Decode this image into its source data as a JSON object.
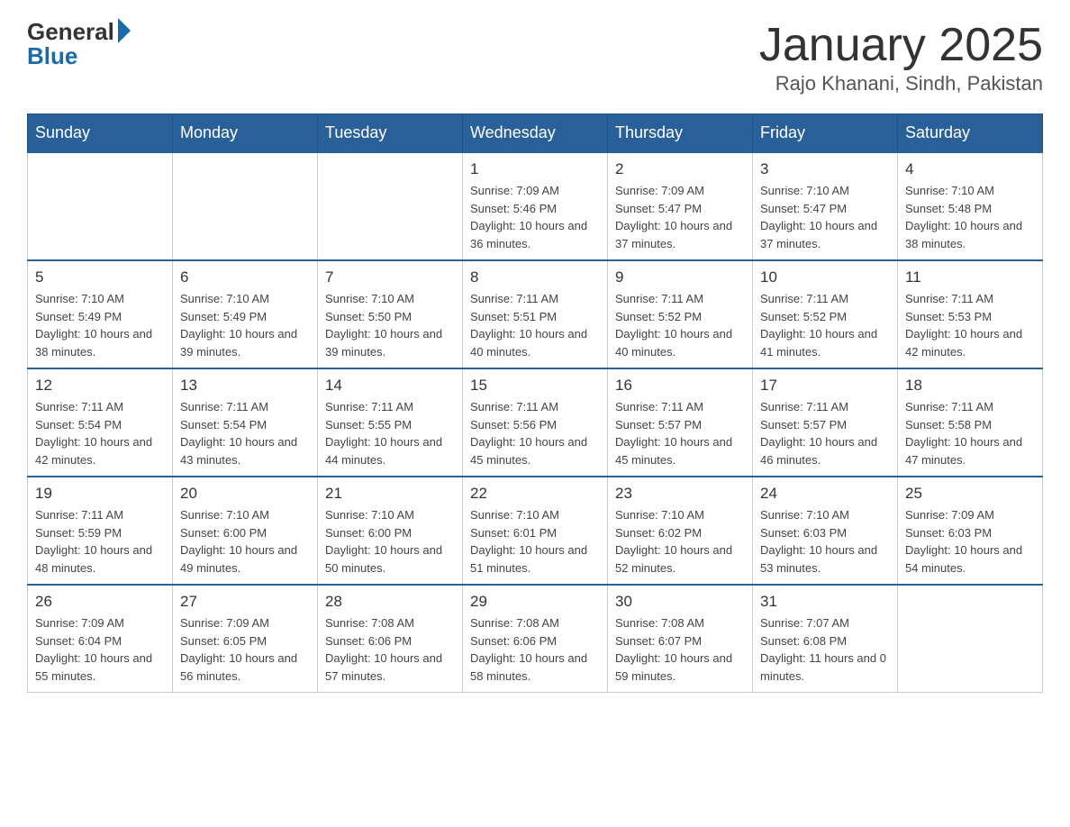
{
  "header": {
    "logo_general": "General",
    "logo_blue": "Blue",
    "month_title": "January 2025",
    "location": "Rajo Khanani, Sindh, Pakistan"
  },
  "weekdays": [
    "Sunday",
    "Monday",
    "Tuesday",
    "Wednesday",
    "Thursday",
    "Friday",
    "Saturday"
  ],
  "weeks": [
    [
      {
        "day": "",
        "info": ""
      },
      {
        "day": "",
        "info": ""
      },
      {
        "day": "",
        "info": ""
      },
      {
        "day": "1",
        "info": "Sunrise: 7:09 AM\nSunset: 5:46 PM\nDaylight: 10 hours and 36 minutes."
      },
      {
        "day": "2",
        "info": "Sunrise: 7:09 AM\nSunset: 5:47 PM\nDaylight: 10 hours and 37 minutes."
      },
      {
        "day": "3",
        "info": "Sunrise: 7:10 AM\nSunset: 5:47 PM\nDaylight: 10 hours and 37 minutes."
      },
      {
        "day": "4",
        "info": "Sunrise: 7:10 AM\nSunset: 5:48 PM\nDaylight: 10 hours and 38 minutes."
      }
    ],
    [
      {
        "day": "5",
        "info": "Sunrise: 7:10 AM\nSunset: 5:49 PM\nDaylight: 10 hours and 38 minutes."
      },
      {
        "day": "6",
        "info": "Sunrise: 7:10 AM\nSunset: 5:49 PM\nDaylight: 10 hours and 39 minutes."
      },
      {
        "day": "7",
        "info": "Sunrise: 7:10 AM\nSunset: 5:50 PM\nDaylight: 10 hours and 39 minutes."
      },
      {
        "day": "8",
        "info": "Sunrise: 7:11 AM\nSunset: 5:51 PM\nDaylight: 10 hours and 40 minutes."
      },
      {
        "day": "9",
        "info": "Sunrise: 7:11 AM\nSunset: 5:52 PM\nDaylight: 10 hours and 40 minutes."
      },
      {
        "day": "10",
        "info": "Sunrise: 7:11 AM\nSunset: 5:52 PM\nDaylight: 10 hours and 41 minutes."
      },
      {
        "day": "11",
        "info": "Sunrise: 7:11 AM\nSunset: 5:53 PM\nDaylight: 10 hours and 42 minutes."
      }
    ],
    [
      {
        "day": "12",
        "info": "Sunrise: 7:11 AM\nSunset: 5:54 PM\nDaylight: 10 hours and 42 minutes."
      },
      {
        "day": "13",
        "info": "Sunrise: 7:11 AM\nSunset: 5:54 PM\nDaylight: 10 hours and 43 minutes."
      },
      {
        "day": "14",
        "info": "Sunrise: 7:11 AM\nSunset: 5:55 PM\nDaylight: 10 hours and 44 minutes."
      },
      {
        "day": "15",
        "info": "Sunrise: 7:11 AM\nSunset: 5:56 PM\nDaylight: 10 hours and 45 minutes."
      },
      {
        "day": "16",
        "info": "Sunrise: 7:11 AM\nSunset: 5:57 PM\nDaylight: 10 hours and 45 minutes."
      },
      {
        "day": "17",
        "info": "Sunrise: 7:11 AM\nSunset: 5:57 PM\nDaylight: 10 hours and 46 minutes."
      },
      {
        "day": "18",
        "info": "Sunrise: 7:11 AM\nSunset: 5:58 PM\nDaylight: 10 hours and 47 minutes."
      }
    ],
    [
      {
        "day": "19",
        "info": "Sunrise: 7:11 AM\nSunset: 5:59 PM\nDaylight: 10 hours and 48 minutes."
      },
      {
        "day": "20",
        "info": "Sunrise: 7:10 AM\nSunset: 6:00 PM\nDaylight: 10 hours and 49 minutes."
      },
      {
        "day": "21",
        "info": "Sunrise: 7:10 AM\nSunset: 6:00 PM\nDaylight: 10 hours and 50 minutes."
      },
      {
        "day": "22",
        "info": "Sunrise: 7:10 AM\nSunset: 6:01 PM\nDaylight: 10 hours and 51 minutes."
      },
      {
        "day": "23",
        "info": "Sunrise: 7:10 AM\nSunset: 6:02 PM\nDaylight: 10 hours and 52 minutes."
      },
      {
        "day": "24",
        "info": "Sunrise: 7:10 AM\nSunset: 6:03 PM\nDaylight: 10 hours and 53 minutes."
      },
      {
        "day": "25",
        "info": "Sunrise: 7:09 AM\nSunset: 6:03 PM\nDaylight: 10 hours and 54 minutes."
      }
    ],
    [
      {
        "day": "26",
        "info": "Sunrise: 7:09 AM\nSunset: 6:04 PM\nDaylight: 10 hours and 55 minutes."
      },
      {
        "day": "27",
        "info": "Sunrise: 7:09 AM\nSunset: 6:05 PM\nDaylight: 10 hours and 56 minutes."
      },
      {
        "day": "28",
        "info": "Sunrise: 7:08 AM\nSunset: 6:06 PM\nDaylight: 10 hours and 57 minutes."
      },
      {
        "day": "29",
        "info": "Sunrise: 7:08 AM\nSunset: 6:06 PM\nDaylight: 10 hours and 58 minutes."
      },
      {
        "day": "30",
        "info": "Sunrise: 7:08 AM\nSunset: 6:07 PM\nDaylight: 10 hours and 59 minutes."
      },
      {
        "day": "31",
        "info": "Sunrise: 7:07 AM\nSunset: 6:08 PM\nDaylight: 11 hours and 0 minutes."
      },
      {
        "day": "",
        "info": ""
      }
    ]
  ]
}
